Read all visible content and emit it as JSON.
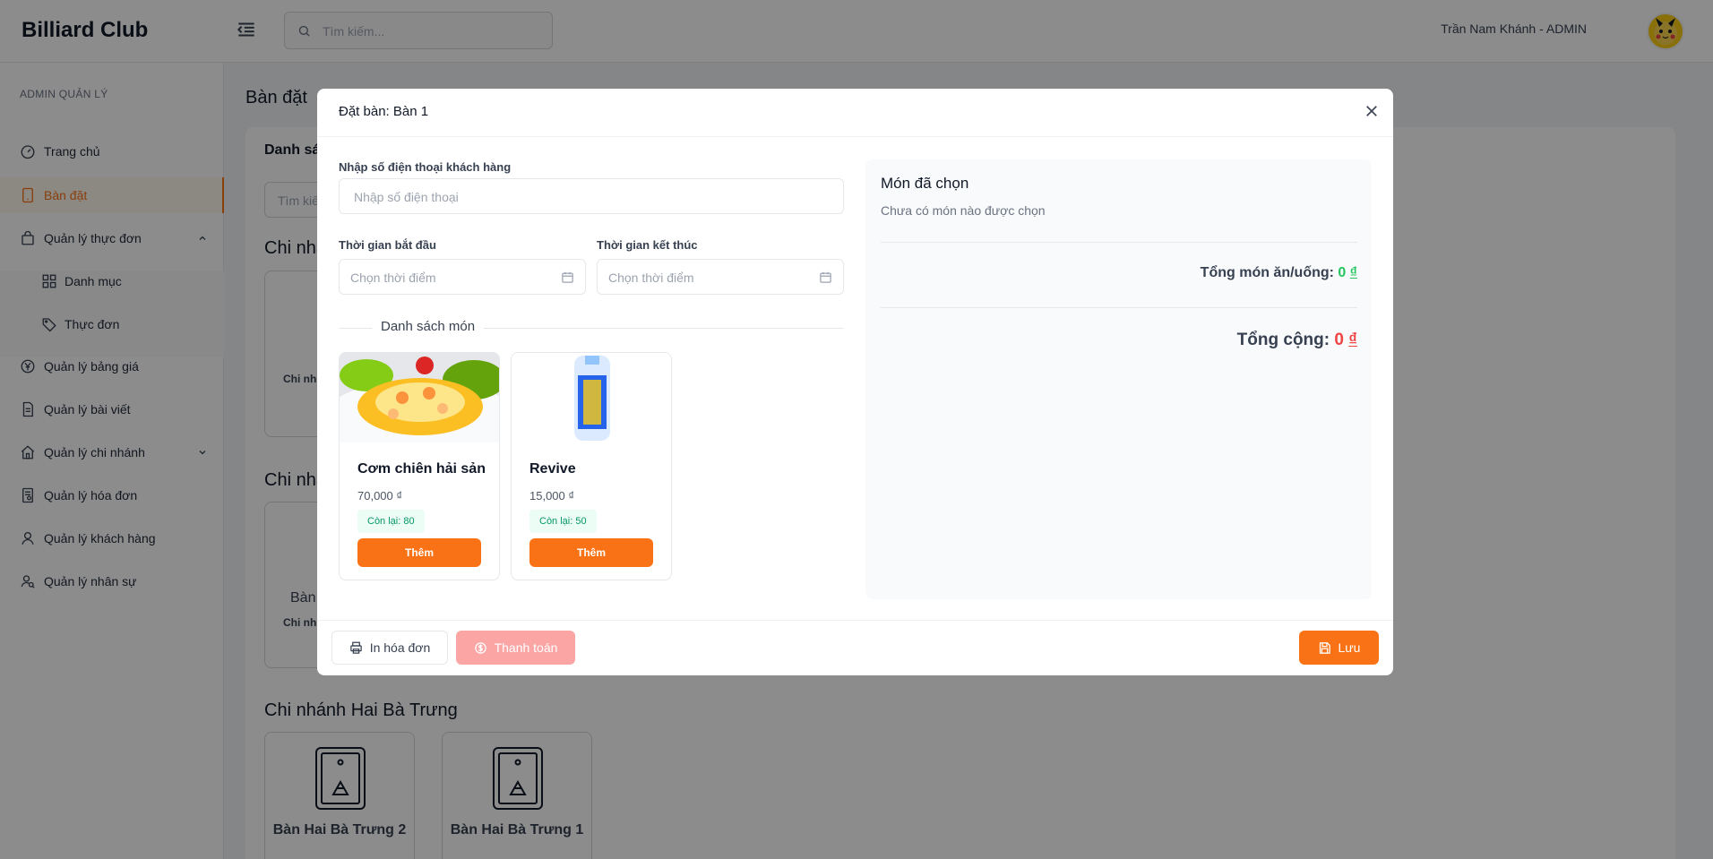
{
  "header": {
    "brand": "Billiard Club",
    "search_placeholder": "Tìm kiếm...",
    "user": "Trần Nam Khánh - ADMIN"
  },
  "sidebar": {
    "section": "ADMIN QUẢN LÝ",
    "items": [
      {
        "label": "Trang chủ",
        "icon": "dashboard-icon"
      },
      {
        "label": "Bàn đặt",
        "icon": "tablet-icon",
        "active": true
      },
      {
        "label": "Quản lý thực đơn",
        "icon": "bag-icon",
        "expanded": true
      },
      {
        "label": "Danh mục",
        "icon": "grid-icon",
        "sub": true
      },
      {
        "label": "Thực đơn",
        "icon": "tag-icon",
        "sub": true
      },
      {
        "label": "Quản lý bảng giá",
        "icon": "yen-icon"
      },
      {
        "label": "Quản lý bài viết",
        "icon": "document-icon"
      },
      {
        "label": "Quản lý chi nhánh",
        "icon": "home-icon",
        "expanded": false
      },
      {
        "label": "Quản lý hóa đơn",
        "icon": "invoice-icon"
      },
      {
        "label": "Quản lý khách hàng",
        "icon": "user-icon"
      },
      {
        "label": "Quản lý nhân sự",
        "icon": "users-icon"
      }
    ]
  },
  "main": {
    "page_title": "Bàn đặt",
    "panel_title": "Danh sá",
    "search_placeholder": "Tìm kiế",
    "branch_1": "Chi nhá",
    "branch_2": "Chi nhá",
    "branch_3": "Chi nhánh Hai Bà Trưng",
    "card_1_branch": "Chi nh",
    "card_2_name": "Bàn",
    "card_2_branch": "Chi nh",
    "tables": [
      {
        "name": "Bàn Hai Bà Trưng 2"
      },
      {
        "name": "Bàn Hai Bà Trưng 1"
      }
    ]
  },
  "modal": {
    "title": "Đặt bàn: Bàn 1",
    "phone_label": "Nhập số điện thoại khách hàng",
    "phone_placeholder": "Nhập số điện thoại",
    "start_label": "Thời gian bắt đầu",
    "start_placeholder": "Chọn thời điểm",
    "end_label": "Thời gian kết thúc",
    "end_placeholder": "Chọn thời điểm",
    "menu_title": "Danh sách món",
    "foods": [
      {
        "name": "Cơm chiên hải sản",
        "price": "70,000 ₫",
        "stock": "Còn lại: 80",
        "add": "Thêm"
      },
      {
        "name": "Revive",
        "price": "15,000 ₫",
        "stock": "Còn lại: 50",
        "add": "Thêm"
      }
    ],
    "selected_title": "Món đã chọn",
    "selected_empty": "Chưa có món nào được chọn",
    "food_total_label": "Tổng món ăn/uống:",
    "food_total_value": "0",
    "grand_total_label": "Tổng cộng:",
    "grand_total_value": "0",
    "currency": "₫",
    "print_button": "In hóa đơn",
    "pay_button": "Thanh toán",
    "save_button": "Lưu"
  }
}
